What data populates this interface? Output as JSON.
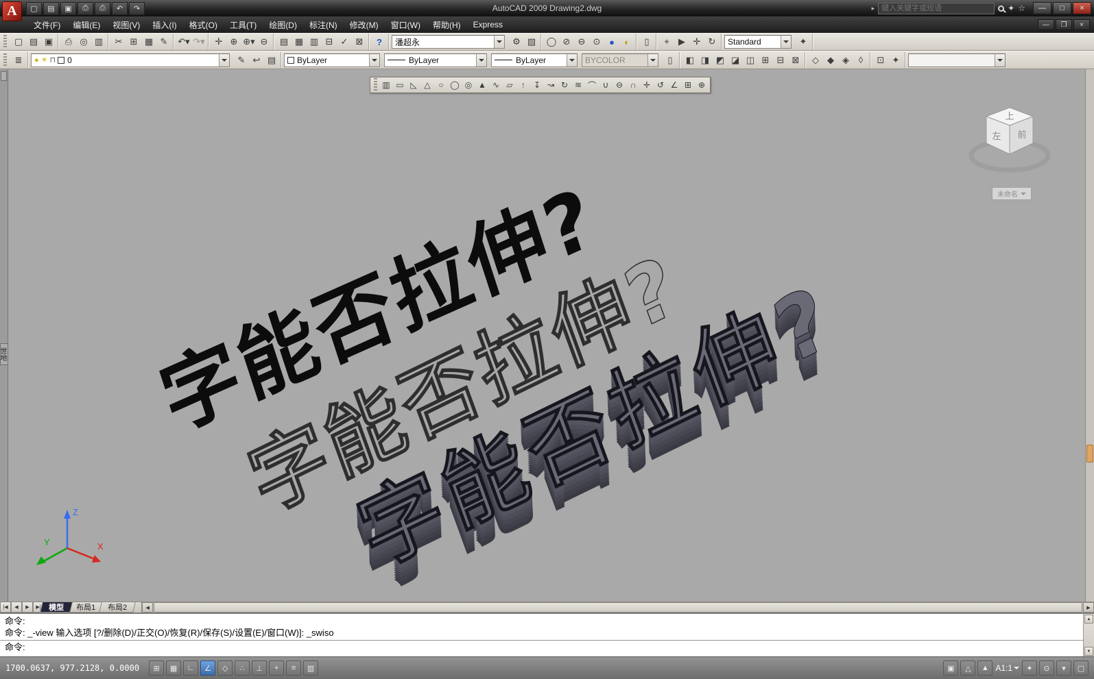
{
  "title_bar": {
    "logo": "A",
    "title": "AutoCAD 2009 Drawing2.dwg",
    "quick_access": [
      {
        "g": "▢",
        "n": "qat-new-icon"
      },
      {
        "g": "▤",
        "n": "qat-open-icon"
      },
      {
        "g": "▣",
        "n": "qat-save-icon"
      },
      {
        "g": "⎙",
        "n": "qat-print-icon"
      },
      {
        "g": "⎙",
        "n": "qat-plot-icon"
      },
      {
        "g": "↶",
        "n": "qat-undo-icon"
      },
      {
        "g": "↷",
        "n": "qat-redo-icon"
      }
    ],
    "search": {
      "arrow": "▸",
      "placeholder": "键入关键字或短语",
      "satellite": "✦",
      "star": "☆"
    },
    "window_controls": [
      {
        "g": "—",
        "n": "app-minimize-icon"
      },
      {
        "g": "□",
        "n": "app-maximize-icon"
      },
      {
        "g": "×",
        "n": "app-close-icon",
        "cls": "close"
      }
    ]
  },
  "menu": {
    "items": [
      "文件(F)",
      "编辑(E)",
      "视图(V)",
      "插入(I)",
      "格式(O)",
      "工具(T)",
      "绘图(D)",
      "标注(N)",
      "修改(M)",
      "窗口(W)",
      "帮助(H)",
      "Express"
    ],
    "doc_controls": [
      {
        "g": "—",
        "n": "doc-minimize-icon"
      },
      {
        "g": "❐",
        "n": "doc-restore-icon"
      },
      {
        "g": "×",
        "n": "doc-close-icon"
      }
    ]
  },
  "standard_toolbar": {
    "g_file": [
      {
        "g": "▢",
        "n": "new-icon"
      },
      {
        "g": "▤",
        "n": "open-icon"
      },
      {
        "g": "▣",
        "n": "save-icon"
      }
    ],
    "g_print": [
      {
        "g": "⎙",
        "n": "print-icon"
      },
      {
        "g": "◎",
        "n": "plot-preview-icon"
      },
      {
        "g": "▥",
        "n": "publish-icon"
      }
    ],
    "g_clip": [
      {
        "g": "✂",
        "n": "cut-icon"
      },
      {
        "g": "⊞",
        "n": "copy-icon"
      },
      {
        "g": "▦",
        "n": "paste-icon"
      },
      {
        "g": "✎",
        "n": "match-properties-icon"
      }
    ],
    "g_undo": [
      {
        "g": "↶▾",
        "n": "undo-icon"
      },
      {
        "g": "↷▾",
        "n": "redo-icon",
        "cls": "dim"
      }
    ],
    "g_zoom": [
      {
        "g": "✛",
        "n": "pan-icon"
      },
      {
        "g": "⊕",
        "n": "zoom-realtime-icon"
      },
      {
        "g": "⊕▾",
        "n": "zoom-window-icon"
      },
      {
        "g": "⊖",
        "n": "zoom-previous-icon"
      }
    ],
    "g_palettes": [
      {
        "g": "▤",
        "n": "properties-icon"
      },
      {
        "g": "▦",
        "n": "designcenter-icon"
      },
      {
        "g": "▥",
        "n": "tool-palettes-icon"
      },
      {
        "g": "⊟",
        "n": "sheetset-manager-icon"
      },
      {
        "g": "✓",
        "n": "markup-set-icon"
      },
      {
        "g": "⊠",
        "n": "quickcalc-icon"
      }
    ],
    "g_help": [
      {
        "g": "?",
        "n": "help-icon",
        "cls": "blue"
      }
    ],
    "workspace_combo": "潘超永",
    "g_ws": [
      {
        "g": "⚙",
        "n": "workspace-settings-icon"
      },
      {
        "g": "▧",
        "n": "workspace-save-icon"
      }
    ],
    "g_render": [
      {
        "g": "◯",
        "n": "sphere-icon"
      },
      {
        "g": "⊘",
        "n": "materials-icon"
      },
      {
        "g": "⊖",
        "n": "planar-mapping-icon"
      },
      {
        "g": "⊙",
        "n": "light-icon"
      },
      {
        "g": "●",
        "n": "render-icon",
        "cls": "blue-fill"
      },
      {
        "g": "◐",
        "n": "sun-icon",
        "cls": "yellow"
      }
    ],
    "g_sheet": [
      {
        "g": "▯",
        "n": "sheet-icon"
      }
    ],
    "g_nav": [
      {
        "g": "⌖",
        "n": "steeringwheel-icon"
      },
      {
        "g": "▶",
        "n": "showmotion-icon"
      },
      {
        "g": "✛",
        "n": "pan-nav-icon"
      },
      {
        "g": "↻",
        "n": "orbit-icon"
      }
    ],
    "style_combo": "Standard",
    "g_end": [
      {
        "g": "✦",
        "n": "style-manager-icon"
      }
    ]
  },
  "layers_toolbar": {
    "g_mgr": [
      {
        "g": "≣",
        "n": "layer-properties-manager-icon"
      }
    ],
    "layer_combo": {
      "bulb": "●",
      "sun": "☀",
      "lock": "⊓",
      "value": "0"
    },
    "g_tools": [
      {
        "g": "✎",
        "n": "make-object-layer-current-icon"
      },
      {
        "g": "↩",
        "n": "layer-previous-icon"
      },
      {
        "g": "▤",
        "n": "layer-states-icon"
      }
    ],
    "color_combo": "ByLayer",
    "linetype_combo": "ByLayer",
    "lineweight_combo": "ByLayer",
    "plotstyle_combo": "BYCOLOR",
    "g_a": [
      {
        "g": "▯",
        "n": "text-style-icon"
      }
    ],
    "g_windows": [
      {
        "g": "◧",
        "n": "viewport-single-icon"
      },
      {
        "g": "◨",
        "n": "viewport-two-icon"
      },
      {
        "g": "◩",
        "n": "viewport-three-icon"
      },
      {
        "g": "◪",
        "n": "viewport-four-icon"
      },
      {
        "g": "◫",
        "n": "viewport-join-icon"
      },
      {
        "g": "⊞",
        "n": "viewport-new-icon"
      },
      {
        "g": "⊟",
        "n": "viewport-named-icon"
      },
      {
        "g": "⊠",
        "n": "viewport-clip-icon"
      }
    ],
    "g_diamond": [
      {
        "g": "◇",
        "n": "isolate-objects-icon"
      },
      {
        "g": "◆",
        "n": "hide-objects-icon"
      },
      {
        "g": "◈",
        "n": "end-isolate-icon"
      },
      {
        "g": "◊",
        "n": "transparency-icon"
      }
    ],
    "g_misc": [
      {
        "g": "⊡",
        "n": "clean-screen-tool-icon"
      },
      {
        "g": "✦",
        "n": "workspace-tool-icon"
      }
    ],
    "empty_combo": ""
  },
  "modeling_toolbar": {
    "icons": [
      {
        "g": "▥",
        "n": "polysolid-icon"
      },
      {
        "g": "▭",
        "n": "box-icon"
      },
      {
        "g": "◺",
        "n": "wedge-icon"
      },
      {
        "g": "△",
        "n": "cone-icon"
      },
      {
        "g": "○",
        "n": "sphere-solid-icon"
      },
      {
        "g": "◯",
        "n": "cylinder-icon"
      },
      {
        "g": "◎",
        "n": "torus-icon"
      },
      {
        "g": "▲",
        "n": "pyramid-icon"
      },
      {
        "g": "∿",
        "n": "helix-icon"
      },
      {
        "g": "▱",
        "n": "planar-surface-icon"
      },
      {
        "g": "↑",
        "n": "extrude-icon"
      },
      {
        "g": "↧",
        "n": "presspull-icon"
      },
      {
        "g": "↝",
        "n": "sweep-icon"
      },
      {
        "g": "↻",
        "n": "revolve-icon"
      },
      {
        "g": "≋",
        "n": "loft-icon"
      },
      {
        "g": "⌒",
        "n": "slice-icon"
      },
      {
        "g": "∪",
        "n": "union-icon"
      },
      {
        "g": "⊖",
        "n": "subtract-icon"
      },
      {
        "g": "∩",
        "n": "intersect-icon"
      },
      {
        "g": "✛",
        "n": "3d-move-icon"
      },
      {
        "g": "↺",
        "n": "3d-rotate-icon"
      },
      {
        "g": "∠",
        "n": "3d-align-icon"
      },
      {
        "g": "⊞",
        "n": "3d-array-icon"
      },
      {
        "g": "⊕",
        "n": "3d-orbit-icon"
      }
    ]
  },
  "viewport": {
    "text": "字能否拉伸?",
    "viewcube": {
      "top": "上",
      "left": "左",
      "front": "前",
      "label": "未命名"
    },
    "ucs": {
      "x": "X",
      "y": "Y",
      "z": "Z"
    }
  },
  "left_panel": {
    "tab": "世地"
  },
  "layout_tabs": {
    "nav": [
      {
        "g": "|◀",
        "n": "first-tab-icon"
      },
      {
        "g": "◀",
        "n": "prev-tab-icon"
      },
      {
        "g": "▶",
        "n": "next-tab-icon"
      },
      {
        "g": "▶|",
        "n": "last-tab-icon"
      }
    ],
    "tabs": [
      "模型",
      "布局1",
      "布局2"
    ],
    "h_left": "◀",
    "h_right": "▶"
  },
  "command": {
    "history": [
      "命令:",
      "命令: _-view 输入选项 [?/删除(D)/正交(O)/恢复(R)/保存(S)/设置(E)/窗口(W)]: _swiso"
    ],
    "prompt": "命令:",
    "scroll_up": "▲",
    "scroll_down": "▼"
  },
  "statusbar": {
    "coordinates": "1700.0637,  977.2128,  0.0000",
    "toggles": [
      {
        "g": "⊞",
        "n": "snap-toggle"
      },
      {
        "g": "▦",
        "n": "grid-toggle"
      },
      {
        "g": "∟",
        "n": "ortho-toggle"
      },
      {
        "g": "∠",
        "n": "polar-toggle",
        "cls": "active"
      },
      {
        "g": "◇",
        "n": "osnap-toggle"
      },
      {
        "g": "∴",
        "n": "otrack-toggle"
      },
      {
        "g": "⊥",
        "n": "ducs-toggle"
      },
      {
        "g": "+",
        "n": "dyn-toggle"
      },
      {
        "g": "≡",
        "n": "lineweight-toggle"
      },
      {
        "g": "▥",
        "n": "quickprops-toggle"
      }
    ],
    "right_icons_a": [
      {
        "g": "▣",
        "n": "model-button"
      },
      {
        "g": "△",
        "n": "annotation-visibility-icon"
      },
      {
        "g": "▲",
        "n": "autoscale-icon"
      }
    ],
    "annotation_scale": "A1:1",
    "right_icons_b": [
      {
        "g": "✦",
        "n": "workspace-switch-icon"
      },
      {
        "g": "⊙",
        "n": "toolbar-lock-icon"
      },
      {
        "g": "▾",
        "n": "status-menu-icon"
      },
      {
        "g": "▢",
        "n": "clean-screen-button"
      }
    ]
  }
}
